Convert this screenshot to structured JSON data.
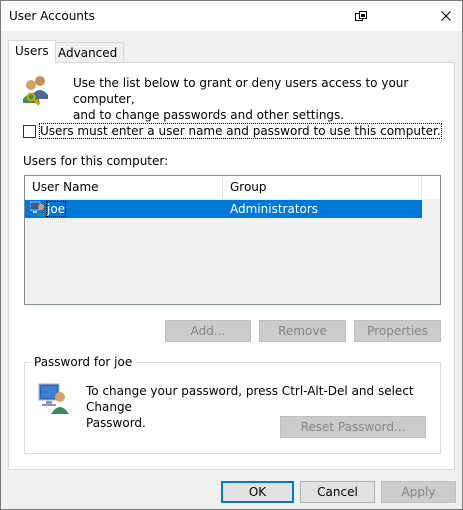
{
  "window": {
    "title": "User Accounts"
  },
  "tabs": [
    {
      "label": "Users",
      "active": true
    },
    {
      "label": "Advanced",
      "active": false
    }
  ],
  "intro": {
    "text_line1": "Use the list below to grant or deny users access to your computer,",
    "text_line2": "and to change passwords and other settings."
  },
  "require_password": {
    "label": "Users must enter a user name and password to use this computer.",
    "checked": false
  },
  "users_list": {
    "label": "Users for this computer:",
    "columns": [
      "User Name",
      "Group"
    ],
    "rows": [
      {
        "user": "joe",
        "group": "Administrators",
        "selected": true
      }
    ]
  },
  "list_buttons": {
    "add": "Add...",
    "remove": "Remove",
    "properties": "Properties"
  },
  "password_group": {
    "title": "Password for joe",
    "text_line1": "To change your password, press Ctrl-Alt-Del and select Change",
    "text_line2": "Password.",
    "reset_button": "Reset Password..."
  },
  "dialog_buttons": {
    "ok": "OK",
    "cancel": "Cancel",
    "apply": "Apply"
  },
  "colors": {
    "selection": "#0078d7",
    "accent": "#0078d7"
  }
}
